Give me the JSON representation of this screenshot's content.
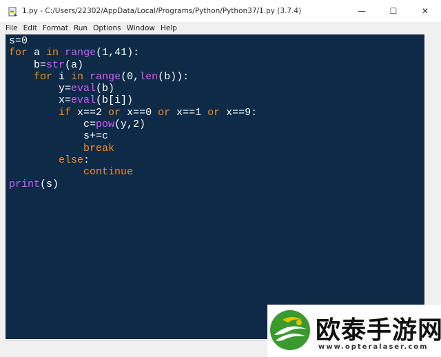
{
  "window": {
    "title": "1.py - C:/Users/22302/AppData/Local/Programs/Python/Python37/1.py (3.7.4)",
    "controls": {
      "minimize": "—",
      "maximize": "☐",
      "close": "✕"
    }
  },
  "menu": {
    "items": [
      "File",
      "Edit",
      "Format",
      "Run",
      "Options",
      "Window",
      "Help"
    ]
  },
  "editor": {
    "background": "#0e2a47",
    "colors": {
      "keyword": "#ff8a1a",
      "builtin": "#d05cff",
      "text": "#ffffff"
    },
    "lines": [
      [
        {
          "t": "s=0",
          "c": "plain"
        }
      ],
      [
        {
          "t": "for",
          "c": "kw"
        },
        {
          "t": " a ",
          "c": "plain"
        },
        {
          "t": "in",
          "c": "kw"
        },
        {
          "t": " ",
          "c": "plain"
        },
        {
          "t": "range",
          "c": "bi"
        },
        {
          "t": "(1,41):",
          "c": "plain"
        }
      ],
      [
        {
          "t": "    b=",
          "c": "plain"
        },
        {
          "t": "str",
          "c": "bi"
        },
        {
          "t": "(a)",
          "c": "plain"
        }
      ],
      [
        {
          "t": "    ",
          "c": "plain"
        },
        {
          "t": "for",
          "c": "kw"
        },
        {
          "t": " i ",
          "c": "plain"
        },
        {
          "t": "in",
          "c": "kw"
        },
        {
          "t": " ",
          "c": "plain"
        },
        {
          "t": "range",
          "c": "bi"
        },
        {
          "t": "(0,",
          "c": "plain"
        },
        {
          "t": "len",
          "c": "bi"
        },
        {
          "t": "(b)):",
          "c": "plain"
        }
      ],
      [
        {
          "t": "        y=",
          "c": "plain"
        },
        {
          "t": "eval",
          "c": "bi"
        },
        {
          "t": "(b)",
          "c": "plain"
        }
      ],
      [
        {
          "t": "        x=",
          "c": "plain"
        },
        {
          "t": "eval",
          "c": "bi"
        },
        {
          "t": "(b[i])",
          "c": "plain"
        }
      ],
      [
        {
          "t": "        ",
          "c": "plain"
        },
        {
          "t": "if",
          "c": "kw"
        },
        {
          "t": " x==2 ",
          "c": "plain"
        },
        {
          "t": "or",
          "c": "kw"
        },
        {
          "t": " x==0 ",
          "c": "plain"
        },
        {
          "t": "or",
          "c": "kw"
        },
        {
          "t": " x==1 ",
          "c": "plain"
        },
        {
          "t": "or",
          "c": "kw"
        },
        {
          "t": " x==9:",
          "c": "plain"
        }
      ],
      [
        {
          "t": "            c=",
          "c": "plain"
        },
        {
          "t": "pow",
          "c": "bi"
        },
        {
          "t": "(y,2)",
          "c": "plain"
        }
      ],
      [
        {
          "t": "            s+=c",
          "c": "plain"
        }
      ],
      [
        {
          "t": "            ",
          "c": "plain"
        },
        {
          "t": "break",
          "c": "kw"
        }
      ],
      [
        {
          "t": "        ",
          "c": "plain"
        },
        {
          "t": "else",
          "c": "kw"
        },
        {
          "t": ":",
          "c": "plain"
        }
      ],
      [
        {
          "t": "            ",
          "c": "plain"
        },
        {
          "t": "continue",
          "c": "kw"
        }
      ],
      [
        {
          "t": "print",
          "c": "bi"
        },
        {
          "t": "(s)",
          "c": "plain"
        }
      ]
    ]
  },
  "watermark": {
    "title": "欧泰手游网",
    "url": "www.opteralaser.com"
  }
}
